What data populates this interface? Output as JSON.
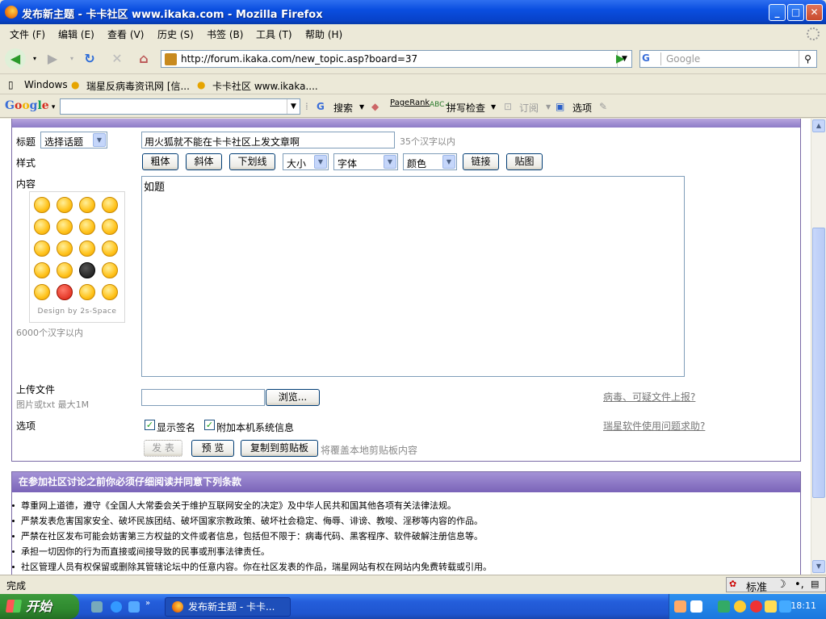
{
  "window": {
    "title": "发布新主题 - 卡卡社区 www.ikaka.com - Mozilla Firefox"
  },
  "menu": [
    "文件 (F)",
    "编辑 (E)",
    "查看 (V)",
    "历史 (S)",
    "书签 (B)",
    "工具 (T)",
    "帮助 (H)"
  ],
  "nav": {
    "url": "http://forum.ikaka.com/new_topic.asp?board=37",
    "search_placeholder": "Google",
    "search_engine": "G"
  },
  "bookmarks": [
    "Windows",
    "瑞星反病毒资讯网 [信...",
    "卡卡社区 www.ikaka...."
  ],
  "google_toolbar": {
    "logo": "Google",
    "search": "搜索",
    "pagerank": "PageRank",
    "spell": "拼写检查",
    "subscribe": "订阅",
    "options": "选项"
  },
  "form": {
    "title_label": "标题",
    "topic_select": "选择话题",
    "title_value": "用火狐就不能在卡卡社区上发文章啊",
    "title_hint": "35个汉字以内",
    "style_label": "样式",
    "style_buttons": [
      "粗体",
      "斜体",
      "下划线"
    ],
    "size_select": "大小",
    "font_select": "字体",
    "color_select": "颜色",
    "link_button": "链接",
    "image_button": "贴图",
    "content_label": "内容",
    "content_value": "如题",
    "smiley_credit": "Design by 2s-Space",
    "content_hint": "6000个汉字以内",
    "upload_label": "上传文件",
    "upload_hint": "图片或txt 最大1M",
    "browse_button": "浏览...",
    "virus_link": "病毒、可疑文件上报?",
    "options_label": "选项",
    "show_signature": "显示签名",
    "show_signature_checked": true,
    "attach_sysinfo": "附加本机系统信息",
    "attach_sysinfo_checked": true,
    "help_link": "瑞星软件使用问题求助?",
    "submit_button": "发 表",
    "preview_button": "预 览",
    "copy_button": "复制到剪贴板",
    "copy_hint": "将覆盖本地剪贴板内容"
  },
  "rules": {
    "header": "在参加社区讨论之前你必须仔细阅读并同意下列条款",
    "items": [
      "尊重网上道德，遵守《全国人大常委会关于维护互联网安全的决定》及中华人民共和国其他各项有关法律法规。",
      "严禁发表危害国家安全、破坏民族团结、破坏国家宗教政策、破坏社会稳定、侮辱、诽谤、教唆、淫秽等内容的作品。",
      "严禁在社区发布可能会妨害第三方权益的文件或者信息，包括但不限于：病毒代码、黑客程序、软件破解注册信息等。",
      "承担一切因你的行为而直接或间接导致的民事或刑事法律责任。",
      "社区管理人员有权保留或删除其管辖论坛中的任意内容。你在社区发表的作品，瑞星网站有权在网站内免费转载或引用。"
    ]
  },
  "status": {
    "text": "完成",
    "ime": "标准"
  },
  "taskbar": {
    "start": "开始",
    "task": "发布新主题 - 卡卡...",
    "clock": "18:11"
  }
}
